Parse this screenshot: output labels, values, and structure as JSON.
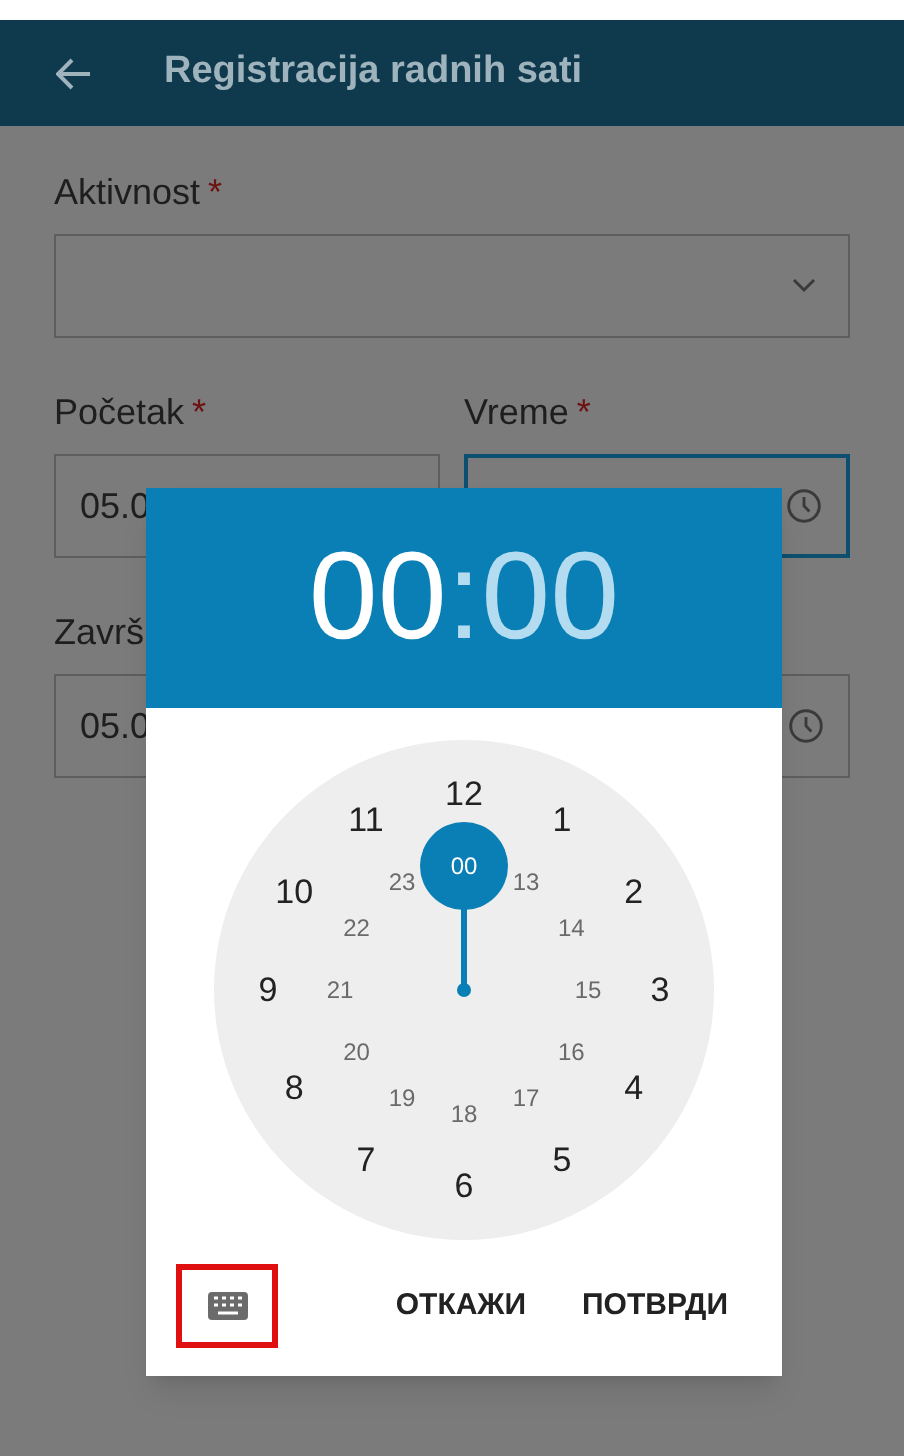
{
  "app_bar": {
    "title": "Registracija radnih sati"
  },
  "form": {
    "activity": {
      "label": "Aktivnost",
      "required_mark": "*"
    },
    "start": {
      "label": "Početak",
      "required_mark": "*",
      "date": "05.0"
    },
    "time": {
      "label": "Vreme",
      "required_mark": "*",
      "focused": true
    },
    "end": {
      "label": "Završ",
      "date": "05.0"
    }
  },
  "time_picker": {
    "hours": {
      "value": "00",
      "selected": true
    },
    "separator": ":",
    "minutes": {
      "value": "00",
      "selected": false
    },
    "outer": [
      {
        "label": "12",
        "selected": false
      },
      {
        "label": "1",
        "selected": false
      },
      {
        "label": "2",
        "selected": false
      },
      {
        "label": "3",
        "selected": false
      },
      {
        "label": "4",
        "selected": false
      },
      {
        "label": "5",
        "selected": false
      },
      {
        "label": "6",
        "selected": false
      },
      {
        "label": "7",
        "selected": false
      },
      {
        "label": "8",
        "selected": false
      },
      {
        "label": "9",
        "selected": false
      },
      {
        "label": "10",
        "selected": false
      },
      {
        "label": "11",
        "selected": false
      }
    ],
    "inner": [
      {
        "label": "00",
        "selected": true
      },
      {
        "label": "13",
        "selected": false
      },
      {
        "label": "14",
        "selected": false
      },
      {
        "label": "15",
        "selected": false
      },
      {
        "label": "16",
        "selected": false
      },
      {
        "label": "17",
        "selected": false
      },
      {
        "label": "18",
        "selected": false
      },
      {
        "label": "19",
        "selected": false
      },
      {
        "label": "20",
        "selected": false
      },
      {
        "label": "21",
        "selected": false
      },
      {
        "label": "22",
        "selected": false
      },
      {
        "label": "23",
        "selected": false
      }
    ],
    "buttons": [
      "ОТКАЖИ",
      "ПОТВРДИ"
    ]
  }
}
